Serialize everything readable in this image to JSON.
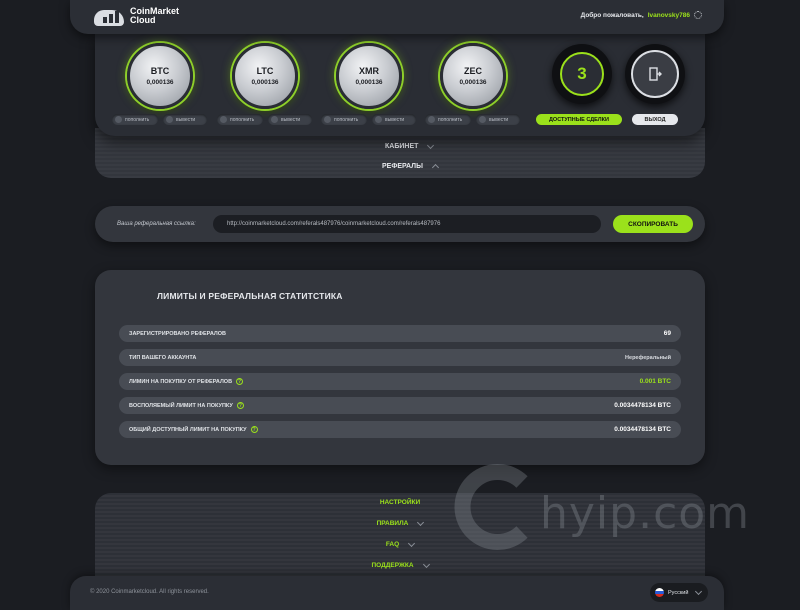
{
  "header": {
    "logo_text_1": "CoinMarket",
    "logo_text_2": "Cloud",
    "welcome_text": "Добро пожаловать,",
    "username": "Ivanovsky786"
  },
  "coins": [
    {
      "symbol": "BTC",
      "value": "0,000136",
      "deposit_label": "пополнить",
      "withdraw_label": "вывести"
    },
    {
      "symbol": "LTC",
      "value": "0,000136",
      "deposit_label": "пополнить",
      "withdraw_label": "вывести"
    },
    {
      "symbol": "XMR",
      "value": "0,000136",
      "deposit_label": "пополнить",
      "withdraw_label": "вывести"
    },
    {
      "symbol": "ZEC",
      "value": "0,000136",
      "deposit_label": "пополнить",
      "withdraw_label": "вывести"
    }
  ],
  "deals": {
    "count": "3",
    "label": "ДОСТУПНЫЕ СДЕЛКИ"
  },
  "exit": {
    "label": "ВЫХОД",
    "icon": "exit-door-icon"
  },
  "menu": {
    "cabinet": "КАБИНЕТ",
    "referrals": "РЕФЕРАЛЫ"
  },
  "referral": {
    "label": "Ваша реферальная ссылка:",
    "link": "http://coinmarketcloud.com/referals487976/coinmarketcloud.com/referals487976",
    "copy_label": "СКОПИРОВАТЬ"
  },
  "limits": {
    "title": "ЛИМИТЫ И РЕФЕРАЛЬНАЯ СТАТИТСТИКА",
    "rows": [
      {
        "label": "ЗАРЕГИСТРИРОВАНО РЕФЕРАЛОВ",
        "value": "69"
      },
      {
        "label": "ТИП ВАШЕГО АККАУНТА",
        "value": "Нереферальный"
      },
      {
        "label": "ЛИМИН НА ПОКУПКУ ОТ РЕФЕРАЛОВ",
        "value": "0.001 BTC"
      },
      {
        "label": "ВОСПОЛЯЕМЫЙ ЛИМИТ НА ПОКУПКУ",
        "value": "0.0034478134 BTC"
      },
      {
        "label": "ОБЩИЙ ДОСТУПНЫЙ ЛИМИТ НА ПОКУПКУ",
        "value": "0.0034478134 BTC"
      }
    ]
  },
  "bottom_menu": {
    "settings": "НАСТРОЙКИ",
    "rules": "ПРАВИЛА",
    "faq": "FAQ",
    "support": "ПОДДЕРЖКА"
  },
  "footer": {
    "copyright": "© 2020 Coinmarketcloud. All rights reserved.",
    "language": "Русский"
  },
  "watermark": {
    "text": "hyip.com"
  },
  "colors": {
    "accent": "#9be11b",
    "background": "#1b1d22",
    "panel": "#33363d"
  }
}
